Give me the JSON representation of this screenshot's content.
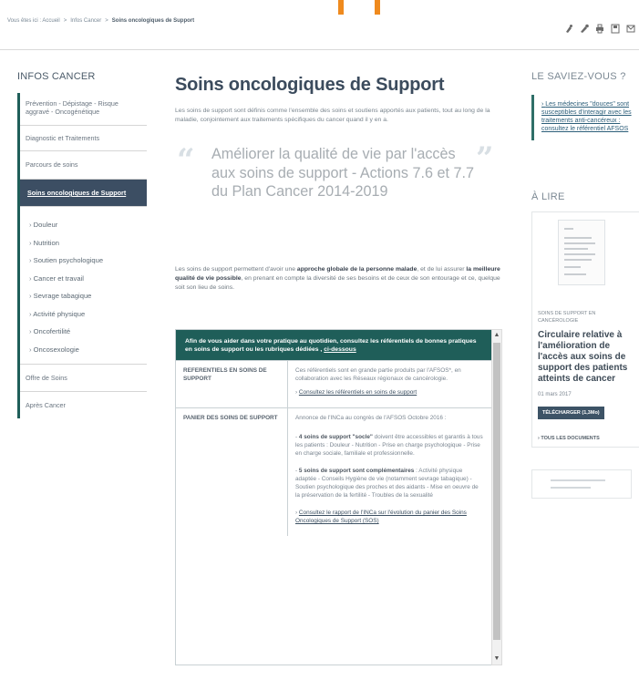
{
  "breadcrumb": {
    "prefix": "Vous êtes ici :",
    "items": [
      "Accueil",
      "Infos Cancer",
      "Soins oncologiques de Support"
    ]
  },
  "tools": [
    {
      "icon": "text-decrease-icon"
    },
    {
      "icon": "text-increase-icon"
    },
    {
      "icon": "print-icon"
    },
    {
      "icon": "save-icon"
    },
    {
      "icon": "share-icon"
    }
  ],
  "sidebar": {
    "title": "INFOS CANCER",
    "items": [
      "Prévention - Dépistage - Risque aggravé - Oncogénétique",
      "Diagnostic et Traitements",
      "Parcours de soins",
      "Soins oncologiques de Support"
    ],
    "subitems": [
      "Douleur",
      "Nutrition",
      "Soutien psychologique",
      "Cancer et travail",
      "Sevrage tabagique",
      "Activité physique",
      "Oncofertilité",
      "Oncosexologie"
    ],
    "bottom_items": [
      "Offre de Soins",
      "Après Cancer"
    ]
  },
  "main": {
    "title": "Soins oncologiques de Support",
    "intro": "Les soins de support sont définis comme l'ensemble des soins et soutiens apportés aux patients, tout au long de la maladie, conjointement aux traitements spécifiques du cancer quand il y en a.",
    "quote": "Améliorer la qualité de vie par l'accès aux soins de support - Actions 7.6 et 7.7 du Plan Cancer 2014-2019",
    "para_pre": "Les soins de support permettent d'avoir une ",
    "para_b1": "approche globale de la personne malade",
    "para_mid": ", et de lui assurer ",
    "para_b2": "la meilleure qualité de vie possible",
    "para_post": ", en prenant en compte la diversité de ses besoins et de ceux de son entourage et ce, quelque soit son lieu de soins.",
    "box": {
      "header": "Afin de vous aider dans votre pratique au quotidien, consultez les référentiels de bonnes pratiques en soins de support ou les rubriques dédiées",
      "header_link": "ci-dessous",
      "rows": [
        {
          "label": "REFERENTIELS EN SOINS DE SUPPORT",
          "text": "Ces référentiels sont en grande partie produits par l'AFSOS*, en collaboration avec les Réseaux régionaux de cancérologie.",
          "link": "Consultez les référentiels en soins de support"
        },
        {
          "label": "PANIER DES SOINS DE SUPPORT",
          "text1": "Annonce de l'INCa au congrès de l'AFSOS Octobre 2016 :",
          "b1": "4 soins de support \"socle\"",
          "text2": " doivent être accessibles et garantis à tous les patients : Douleur - Nutrition - Prise en charge psychologique - Prise en charge sociale, familiale et professionnelle.",
          "b2": "5 soins de support sont complémentaires",
          "text3": " : Activité physique adaptée - Conseils Hygiène de vie (notamment sevrage tabagique) - Soutien psychologique des proches et des aidants - Mise en oeuvre de la préservation de la fertilité - Troubles de la sexualité",
          "link": "Consultez le rapport de l'INCa sur l'évolution du panier des Soins Oncologiques de Support (SOS)"
        }
      ]
    }
  },
  "right": {
    "saviez_title": "LE SAVIEZ-VOUS ?",
    "saviez_link": "Les médecines \"douces\" sont susceptibles d'interagir avec les traitements anti-cancéreux : consultez le référentiel AFSOS",
    "alire_title": "À LIRE",
    "doc": {
      "category": "SOINS DE SUPPORT EN CANCÉROLOGIE",
      "title": "Circulaire relative à l'amélioration de l'accès aux soins de support des patients atteints de cancer",
      "date": "01 mars 2017",
      "button": "TÉLÉCHARGER (1,3Mo)",
      "all": "TOUS LES DOCUMENTS"
    }
  }
}
